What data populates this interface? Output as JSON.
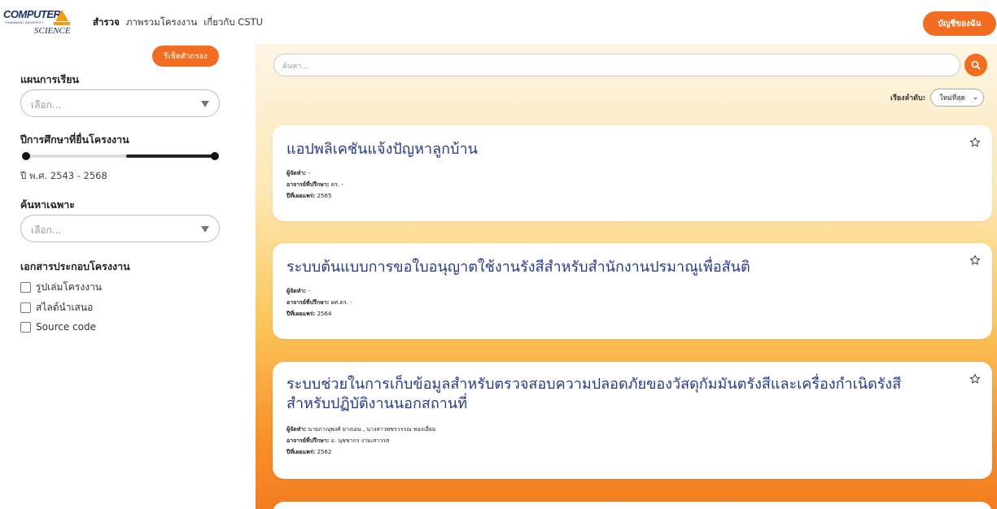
{
  "header": {
    "logo": {
      "line1": "COMPUTER",
      "line2": "THAMMASAT UNIVERSITY",
      "line3": "SCIENCE"
    },
    "nav": [
      "สำรวจ",
      "ภาพรวมโครงงาน",
      "เกี่ยวกับ CSTU"
    ],
    "account_label": "บัญชีของฉัน"
  },
  "sidebar": {
    "reset_label": "รีเซ็ตตัวกรอง",
    "study_plan": {
      "title": "แผนการเรียน",
      "placeholder": "เลือก..."
    },
    "year": {
      "title": "ปีการศึกษาที่ยื่นโครงงาน",
      "range_text": "ปี พ.ศ. 2543 - 2568",
      "min": 2543,
      "max": 2568,
      "selected_min": 2543,
      "selected_max": 2568
    },
    "specific": {
      "title": "ค้นหาเฉพาะ",
      "placeholder": "เลือก..."
    },
    "documents": {
      "title": "เอกสารประกอบโครงงาน",
      "items": [
        {
          "label": "รูปเล่มโครงงาน",
          "checked": false
        },
        {
          "label": "สไลด์นำเสนอ",
          "checked": false
        },
        {
          "label": "Source code",
          "checked": false
        }
      ]
    }
  },
  "main": {
    "search_placeholder": "ค้นหา...",
    "sort": {
      "label": "เรียงลำดับ:",
      "value": "ใหม่ที่สุด"
    },
    "cards": [
      {
        "title": "แอปพลิเคชันแจ้งปัญหาลูกบ้าน",
        "authors_label": "ผู้จัดทำ:",
        "authors": "-",
        "advisor_label": "อาจารย์ที่ปรึกษา:",
        "advisor": "ดร. -",
        "year_label": "ปีที่เผยแพร่:",
        "year": "2565"
      },
      {
        "title": "ระบบต้นแบบการขอใบอนุญาตใช้งานรังสีสำหรับสำนักงานปรมาณูเพื่อสันติ",
        "authors_label": "ผู้จัดทำ:",
        "authors": "-",
        "advisor_label": "อาจารย์ที่ปรึกษา:",
        "advisor": "ผศ.ดร. -",
        "year_label": "ปีที่เผยแพร่:",
        "year": "2564"
      },
      {
        "title": "ระบบช่วยในการเก็บข้อมูลสำหรับตรวจสอบความปลอดภัยของวัสดุกัมมันตรังสีและเครื่องกำเนิดรังสีสำหรับปฏิบัติงานนอกสถานที่",
        "authors_label": "ผู้จัดทำ:",
        "authors": "นายภาณุพงศ์ ยางเอน , นางสาวพชรวรรณ ทองเอี่ยม",
        "advisor_label": "อาจารย์ที่ปรึกษา:",
        "advisor": "อ. นุชชากร งามเสาวรส",
        "year_label": "ปีที่เผยแพร่:",
        "year": "2562"
      }
    ]
  },
  "colors": {
    "accent": "#f26d21",
    "title_blue": "#243a8a",
    "logo_navy": "#1c2f6b",
    "logo_orange": "#f39c12"
  }
}
